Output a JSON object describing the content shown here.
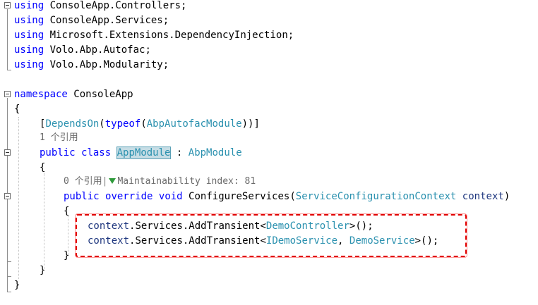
{
  "usings": {
    "kw": "using",
    "u1": "ConsoleApp.Controllers;",
    "u2": "ConsoleApp.Services;",
    "u3": "Microsoft.Extensions.DependencyInjection;",
    "u4": "Volo.Abp.Autofac;",
    "u5": "Volo.Abp.Modularity;"
  },
  "namespace": {
    "kw": "namespace",
    "name": "ConsoleApp",
    "open": "{",
    "close": "}"
  },
  "attribute": {
    "open": "[",
    "name": "DependsOn",
    "typeof_kw": "typeof",
    "arg": "AbpAutofacModule",
    "close": "))]"
  },
  "class_lens": "1 个引用",
  "class_decl": {
    "kw1": "public",
    "kw2": "class",
    "name": "AppModule",
    "colon": " : ",
    "base": "AbpModule",
    "open": "{",
    "close": "}"
  },
  "method_lens": {
    "refs": "0 个引用",
    "sep": "|",
    "maintainability": "Maintainability index: 81"
  },
  "method_decl": {
    "kw1": "public",
    "kw2": "override",
    "kw3": "void",
    "name": "ConfigureServices",
    "param_type": "ServiceConfigurationContext",
    "param_name": "context",
    "open": "{",
    "close": "}"
  },
  "body": {
    "line1": {
      "ctx": "context",
      "call": ".Services.AddTransient<",
      "t1": "DemoController",
      "tail": ">();"
    },
    "line2": {
      "ctx": "context",
      "call": ".Services.AddTransient<",
      "t1": "IDemoService",
      "mid": ", ",
      "t2": "DemoService",
      "tail": ">();"
    }
  },
  "colors": {
    "keyword": "#0000ff",
    "type": "#2b91af",
    "parameter": "#1f377f",
    "highlight_border": "#e00000"
  }
}
